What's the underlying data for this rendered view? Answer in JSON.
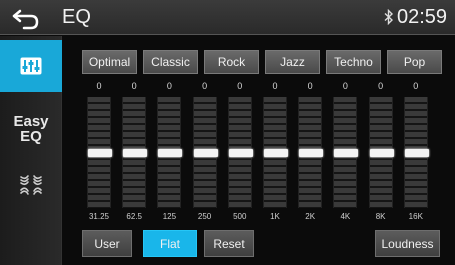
{
  "header": {
    "title": "EQ",
    "clock": "02:59",
    "bluetooth_icon": "bluetooth-icon",
    "back_icon": "back-arrow-icon"
  },
  "sidebar": {
    "items": [
      {
        "name": "equalizer",
        "icon": "equalizer-sliders-icon",
        "selected": true
      },
      {
        "name": "easy-eq",
        "label_line1": "Easy",
        "label_line2": "EQ",
        "selected": false
      },
      {
        "name": "sound-field",
        "icon": "sound-field-icon",
        "selected": false
      }
    ]
  },
  "presets": [
    "Optimal",
    "Classic",
    "Rock",
    "Jazz",
    "Techno",
    "Pop"
  ],
  "bands": [
    {
      "freq": "31.25",
      "value": "0"
    },
    {
      "freq": "62.5",
      "value": "0"
    },
    {
      "freq": "125",
      "value": "0"
    },
    {
      "freq": "250",
      "value": "0"
    },
    {
      "freq": "500",
      "value": "0"
    },
    {
      "freq": "1K",
      "value": "0"
    },
    {
      "freq": "2K",
      "value": "0"
    },
    {
      "freq": "4K",
      "value": "0"
    },
    {
      "freq": "8K",
      "value": "0"
    },
    {
      "freq": "16K",
      "value": "0"
    }
  ],
  "bottom": {
    "user": "User",
    "flat": "Flat",
    "reset": "Reset",
    "loudness": "Loudness"
  },
  "colors": {
    "accent": "#19b6ea",
    "background": "#0b0b0b"
  }
}
